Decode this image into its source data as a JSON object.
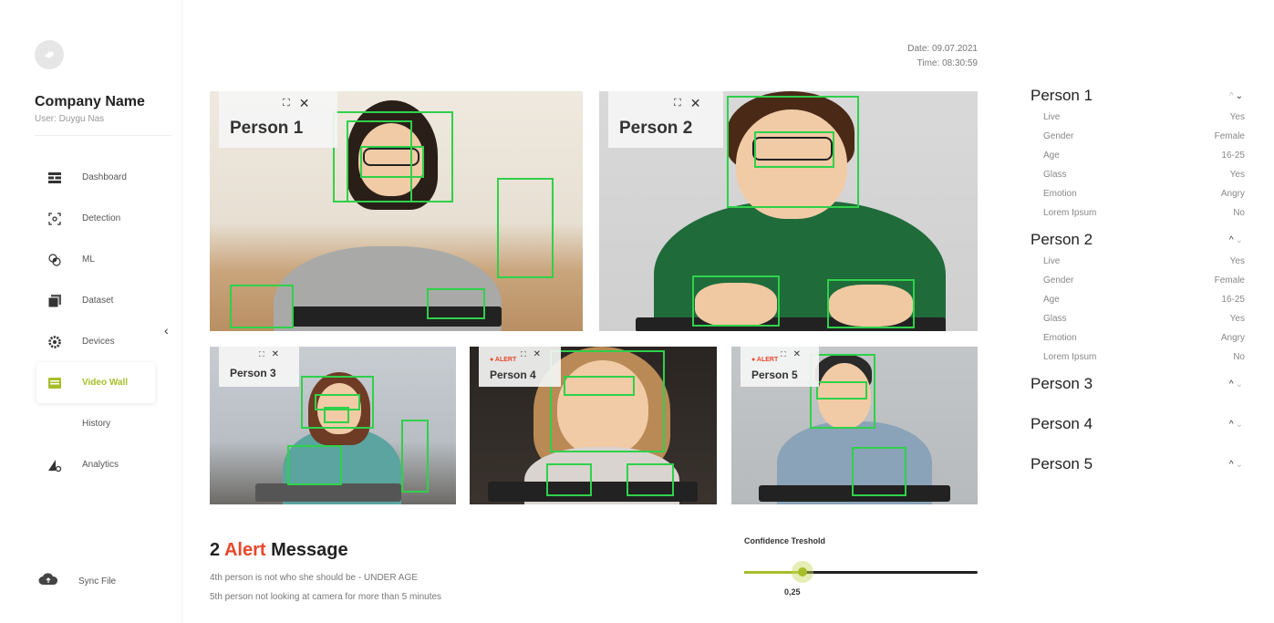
{
  "sidebar": {
    "company": "Company Name",
    "user": "User: Duygu Nas",
    "items": [
      {
        "label": "Dashboard",
        "icon": "dashboard-icon"
      },
      {
        "label": "Detection",
        "icon": "detection-icon"
      },
      {
        "label": "ML",
        "icon": "ml-icon"
      },
      {
        "label": "Dataset",
        "icon": "dataset-icon"
      },
      {
        "label": "Devices",
        "icon": "devices-icon"
      },
      {
        "label": "Video Wall",
        "icon": "video-wall-icon",
        "active": true
      },
      {
        "label": "History",
        "icon": ""
      },
      {
        "label": "Analytics",
        "icon": "analytics-icon"
      }
    ],
    "collapse": "‹",
    "sync_label": "Sync File"
  },
  "header": {
    "date": "Date: 09.07.2021",
    "time": "Time: 08:30:59"
  },
  "tiles": [
    {
      "name": "Person 1",
      "alert": ""
    },
    {
      "name": "Person 2",
      "alert": ""
    },
    {
      "name": "Person 3",
      "alert": ""
    },
    {
      "name": "Person 4",
      "alert": "● ALERT"
    },
    {
      "name": "Person 5",
      "alert": "● ALERT"
    }
  ],
  "controls": {
    "expand": "⛶",
    "close": "✕"
  },
  "alert_message": {
    "count": "2",
    "highlight": "Alert",
    "rest": "Message",
    "lines": [
      "4th person is not who she should be - UNDER AGE",
      "5th person not looking at camera for more than 5 minutes"
    ]
  },
  "confidence": {
    "label": "Confidence Treshold",
    "value": 0.25,
    "value_text": "0,25"
  },
  "panel": {
    "persons": [
      {
        "title": "Person 1",
        "expanded": true,
        "rows": [
          {
            "k": "Live",
            "v": "Yes"
          },
          {
            "k": "Gender",
            "v": "Female"
          },
          {
            "k": "Age",
            "v": "16-25"
          },
          {
            "k": "Glass",
            "v": "Yes"
          },
          {
            "k": "Emotion",
            "v": "Angry"
          },
          {
            "k": "Lorem Ipsum",
            "v": "No"
          }
        ]
      },
      {
        "title": "Person 2",
        "expanded": true,
        "rows": [
          {
            "k": "Live",
            "v": "Yes"
          },
          {
            "k": "Gender",
            "v": "Female"
          },
          {
            "k": "Age",
            "v": "16-25"
          },
          {
            "k": "Glass",
            "v": "Yes"
          },
          {
            "k": "Emotion",
            "v": "Angry"
          },
          {
            "k": "Lorem Ipsum",
            "v": "No"
          }
        ]
      },
      {
        "title": "Person 3",
        "expanded": false,
        "rows": []
      },
      {
        "title": "Person 4",
        "expanded": false,
        "rows": []
      },
      {
        "title": "Person 5",
        "expanded": false,
        "rows": []
      }
    ]
  },
  "colors": {
    "accent": "#a8bd2a",
    "alert": "#e8472a",
    "detection_box": "#2fd14a"
  }
}
